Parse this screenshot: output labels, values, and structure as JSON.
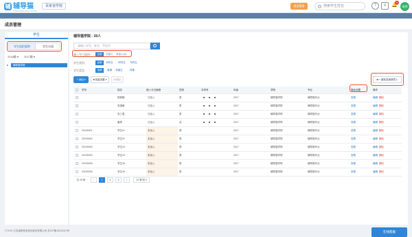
{
  "header": {
    "logo_mark": "辅",
    "logo_text": "辅导猫",
    "logo_sub": "FUDAOMAO EDU TOOLS",
    "school": "百家道学院",
    "orange_btn": "退出登录",
    "search_placeholder": "搜索学生姓名",
    "help_icon": "?",
    "msg_icon": "≡",
    "bell_icon": "🔔",
    "bell_badge": "9",
    "avatar": "老师"
  },
  "breadcrumb": [
    "首页",
    "/",
    "成员管理"
  ],
  "page_title": "成员管理",
  "left": {
    "tab": "学生",
    "btn_org": "学生组织架构",
    "btn_group": "学生分组",
    "filter1": "2018级 ▾",
    "filter2": "2017级 ▾",
    "tree_arrow": "▸",
    "selected": "辅导猫学院"
  },
  "main": {
    "title": "辅导猫学院 - 28人",
    "search_placeholder": "请输入学号、姓名、手机号",
    "filters": [
      {
        "label": "输入今日面授:",
        "chips": [
          {
            "t": "全部",
            "on": true
          },
          {
            "t": "已加入",
            "on": false
          },
          {
            "t": "未加入(4)",
            "on": false
          }
        ]
      },
      {
        "label": "学生类别:",
        "chips": [
          {
            "t": "全部",
            "on": true
          },
          {
            "t": "本科生",
            "on": false
          },
          {
            "t": "研究生",
            "on": false
          },
          {
            "t": "专科生",
            "on": false
          }
        ]
      },
      {
        "label": "学生类型:",
        "chips": [
          {
            "t": "全部",
            "on": true
          },
          {
            "t": "普通",
            "on": false
          },
          {
            "t": "特困生",
            "on": false
          },
          {
            "t": "特殊",
            "on": false
          }
        ]
      }
    ],
    "btn_add": "+ 添加 ▾",
    "btn_batch": "■ 批量设置 ▾",
    "btn_delete": "■ 删除",
    "btn_export": "■ 一键批发面授导入"
  },
  "table": {
    "headers": [
      "学号",
      "姓名",
      "授入今日面授",
      "性别",
      "手机号",
      "年级",
      "学院",
      "专业",
      "隐私设置",
      "操作"
    ],
    "rows": [
      {
        "id": "",
        "name": "那那鹤",
        "status": "已加入",
        "sex": "男",
        "phone": "dots",
        "grade": "2017",
        "college": "辅导猫学院",
        "major": "辅导猫专业",
        "pending": false
      },
      {
        "id": "",
        "name": "张惠敏",
        "status": "已加入",
        "sex": "男",
        "phone": "dots",
        "grade": "2017",
        "college": "辅导猫学院",
        "major": "辅导猫专业",
        "pending": false
      },
      {
        "id": "",
        "name": "张三君",
        "status": "已加入",
        "sex": "男",
        "phone": "dots",
        "grade": "2017",
        "college": "辅导猫学院",
        "major": "辅导猫专业",
        "pending": false
      },
      {
        "id": "",
        "name": "姜男",
        "status": "已加入",
        "sex": "女",
        "phone": "dots",
        "grade": "2017",
        "college": "辅导猫学院",
        "major": "辅导猫专业",
        "pending": false
      },
      {
        "id": "20190001",
        "name": "学生01",
        "status": "未加入",
        "sex": "男",
        "phone": "",
        "grade": "2017",
        "college": "辅导猫学院",
        "major": "辅导猫专业",
        "pending": true
      },
      {
        "id": "20190002",
        "name": "学生02",
        "status": "未加入",
        "sex": "男",
        "phone": "",
        "grade": "2017",
        "college": "辅导猫学院",
        "major": "辅导猫专业",
        "pending": true
      },
      {
        "id": "20190003",
        "name": "学生03",
        "status": "未加入",
        "sex": "男",
        "phone": "",
        "grade": "2017",
        "college": "辅导猫学院",
        "major": "辅导猫专业",
        "pending": true
      },
      {
        "id": "20190004",
        "name": "学生04",
        "status": "未加入",
        "sex": "男",
        "phone": "",
        "grade": "2017",
        "college": "辅导猫学院",
        "major": "辅导猫专业",
        "pending": true
      },
      {
        "id": "20190005",
        "name": "学生05",
        "status": "未加入",
        "sex": "男",
        "phone": "",
        "grade": "2017",
        "college": "辅导猫学院",
        "major": "辅导猫专业",
        "pending": true
      },
      {
        "id": "20190006",
        "name": "学生06",
        "status": "未加入",
        "sex": "男",
        "phone": "",
        "grade": "2017",
        "college": "辅导猫学院",
        "major": "辅导猫专业",
        "pending": true
      }
    ],
    "privacy_label": "查看",
    "edit_label": "编辑",
    "del_label": "删除"
  },
  "pager": {
    "total": "共 28 条",
    "prev": "‹",
    "pages": [
      "1",
      "2",
      "3"
    ],
    "current": "1",
    "next": "›",
    "size": "10 条/页 ▾"
  },
  "footer": "© 2019 江苏省教育信息化股份有限公司 苏ICP备15034314号",
  "cs_button": "在线客服"
}
